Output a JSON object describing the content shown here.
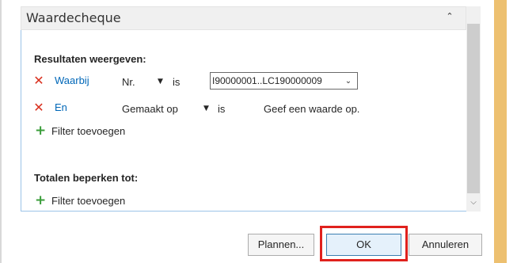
{
  "panel": {
    "title": "Waardecheque",
    "collapse_icon": "chevron-up-icon"
  },
  "results_section": {
    "heading": "Resultaten weergeven:",
    "filters": [
      {
        "remove_icon": "remove-x-icon",
        "connector": "Waarbij",
        "field": "Nr.",
        "operator": "is",
        "value": "I90000001..LC190000009"
      },
      {
        "remove_icon": "remove-x-icon",
        "connector": "En",
        "field": "Gemaakt op",
        "operator": "is",
        "value_placeholder": "Geef een waarde op."
      }
    ],
    "add_filter_label": "Filter toevoegen"
  },
  "limits_section": {
    "heading": "Totalen beperken tot:",
    "add_filter_label": "Filter toevoegen"
  },
  "buttons": {
    "schedule": "Plannen...",
    "ok": "OK",
    "cancel": "Annuleren"
  },
  "colors": {
    "remove_icon": "#d9301e",
    "add_icon": "#3a9d3a",
    "link": "#0067b8",
    "highlight": "#e0211d",
    "side_stripe": "#edc070"
  }
}
